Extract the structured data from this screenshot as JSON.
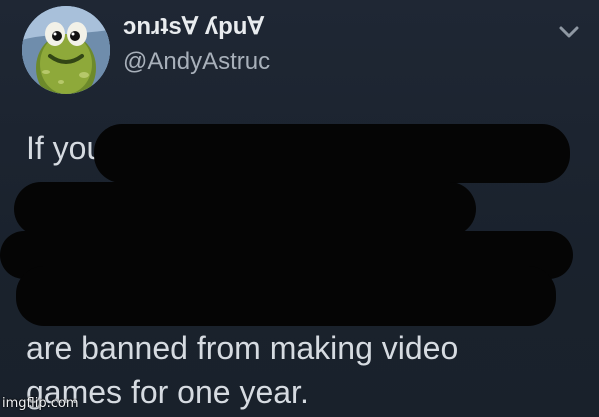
{
  "tweet": {
    "author_display_name": "ɔnɹʇs∀ ʎpu∀",
    "author_handle": "@AndyAstruc",
    "text_start": "If you",
    "text_line_2": "are banned from making video",
    "text_line_3": "games for one year."
  },
  "icons": {
    "menu": "chevron-down-icon"
  },
  "watermark": {
    "text": "imgflip.com"
  },
  "colors": {
    "background": "#1c2430",
    "redaction": "#050505",
    "primary_text": "#e9ecef",
    "secondary_text": "#a8b0ba"
  }
}
